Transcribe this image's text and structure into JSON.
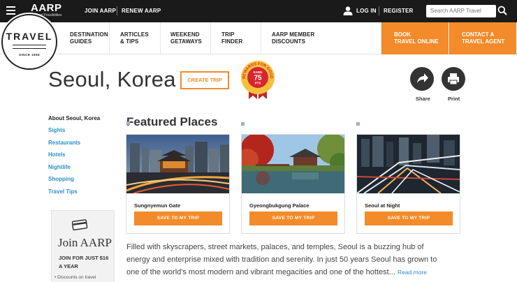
{
  "topbar": {
    "logo": "AARP",
    "logo_tagline": "Real Possibilities",
    "join_label": "JOIN AARP",
    "renew_label": "RENEW AARP",
    "login_label": "LOG IN",
    "register_label": "REGISTER",
    "search_placeholder": "Search AARP Travel"
  },
  "nav": {
    "items": [
      {
        "label": "DESTINATION\nGUIDES"
      },
      {
        "label": "ARTICLES\n& TIPS"
      },
      {
        "label": "WEEKEND\nGETAWAYS"
      },
      {
        "label": "TRIP\nFINDER"
      },
      {
        "label": "AARP MEMBER\nDISCOUNTS"
      }
    ],
    "cta_book": "BOOK\nTRAVEL ONLINE",
    "cta_contact": "CONTACT A\nTRAVEL AGENT"
  },
  "badge": {
    "title": "TRAVEL",
    "since": "SINCE 1958"
  },
  "header": {
    "title": "Seoul, Korea",
    "create_trip": "CREATE TRIP",
    "rewards_ring": "REWARDS FOR GOOD",
    "rewards_top": "EARN",
    "rewards_points": "75",
    "rewards_unit": "PTS",
    "share_label": "Share",
    "print_label": "Print"
  },
  "sidebar": {
    "heading": "About Seoul, Korea",
    "links": [
      "Sights",
      "Restaurants",
      "Hotels",
      "Nightlife",
      "Shopping",
      "Travel Tips"
    ],
    "join_title": "Join AARP",
    "join_sub": "JOIN FOR JUST $16 A YEAR",
    "join_bullet": "• Discounts on travel"
  },
  "featured": {
    "title": "Featured Places",
    "cards": [
      {
        "name": "Sungnyemun Gate",
        "button": "SAVE TO MY TRIP"
      },
      {
        "name": "Gyeongbukgung Palace",
        "button": "SAVE TO MY TRIP"
      },
      {
        "name": "Seoul at Night",
        "button": "SAVE TO MY TRIP"
      }
    ]
  },
  "intro": {
    "text": "Filled with skyscrapers, street markets, palaces, and temples, Seoul is a buzzing hub of energy and enterprise mixed with tradition and serenity. In just 50 years Seoul has grown to one of the world's most modern and vibrant megacities and one of the hottest...",
    "read_more": "Read more"
  },
  "colors": {
    "accent": "#f38b2a",
    "link": "#2a8fc9",
    "topbar": "#1a1a1a"
  },
  "icons": [
    "menu-icon",
    "user-icon",
    "search-icon",
    "share-icon",
    "print-icon",
    "card-icon"
  ]
}
